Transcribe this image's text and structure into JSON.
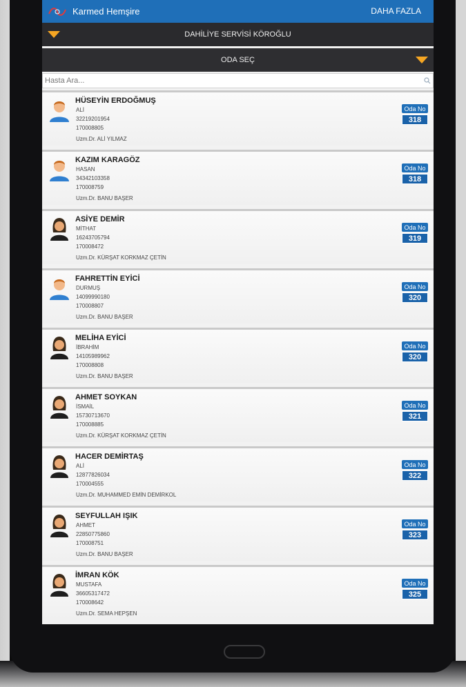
{
  "app": {
    "title": "Karmed Hemşire",
    "more": "DAHA FAZLA"
  },
  "service": {
    "label": "DAHİLİYE SERVİSİ KÖROĞLU"
  },
  "room_select": {
    "label": "ODA SEÇ"
  },
  "search": {
    "placeholder": "Hasta Ara..."
  },
  "room_label": "Oda No",
  "patients": [
    {
      "name": "HÜSEYİN ERDOĞMUŞ",
      "father": "ALİ",
      "id": "32219201954",
      "protocol": "170008805",
      "doctor": "Uzm.Dr. ALİ YILMAZ",
      "room": "318",
      "gender": "male"
    },
    {
      "name": "KAZIM KARAGÖZ",
      "father": "HASAN",
      "id": "34342103358",
      "protocol": "170008759",
      "doctor": "Uzm.Dr. BANU BAŞER",
      "room": "318",
      "gender": "male"
    },
    {
      "name": "ASİYE DEMİR",
      "father": "MİTHAT",
      "id": "16243705794",
      "protocol": "170008472",
      "doctor": "Uzm.Dr. KÜRŞAT KORKMAZ ÇETİN",
      "room": "319",
      "gender": "female"
    },
    {
      "name": "FAHRETTİN EYİCİ",
      "father": "DURMUŞ",
      "id": "14099990180",
      "protocol": "170008807",
      "doctor": "Uzm.Dr. BANU BAŞER",
      "room": "320",
      "gender": "male"
    },
    {
      "name": "MELİHA EYİCİ",
      "father": "İBRAHİM",
      "id": "14105989962",
      "protocol": "170008808",
      "doctor": "Uzm.Dr. BANU BAŞER",
      "room": "320",
      "gender": "female"
    },
    {
      "name": "AHMET SOYKAN",
      "father": "İSMAİL",
      "id": "15730713670",
      "protocol": "170008885",
      "doctor": "Uzm.Dr. KÜRŞAT KORKMAZ ÇETİN",
      "room": "321",
      "gender": "female"
    },
    {
      "name": "HACER DEMİRTAŞ",
      "father": "ALİ",
      "id": "12877826034",
      "protocol": "170004555",
      "doctor": "Uzm.Dr. MUHAMMED EMİN DEMİRKOL",
      "room": "322",
      "gender": "female"
    },
    {
      "name": "SEYFULLAH IŞIK",
      "father": "AHMET",
      "id": "22850775860",
      "protocol": "170008751",
      "doctor": "Uzm.Dr. BANU BAŞER",
      "room": "323",
      "gender": "female"
    },
    {
      "name": "İMRAN KÖK",
      "father": "MUSTAFA",
      "id": "36605317472",
      "protocol": "170008642",
      "doctor": "Uzm.Dr. SEMA HEPŞEN",
      "room": "325",
      "gender": "female"
    }
  ],
  "colors": {
    "appbar": "#1f6fb8",
    "accent": "#f5a623",
    "room_badge": "#1a62a9"
  }
}
